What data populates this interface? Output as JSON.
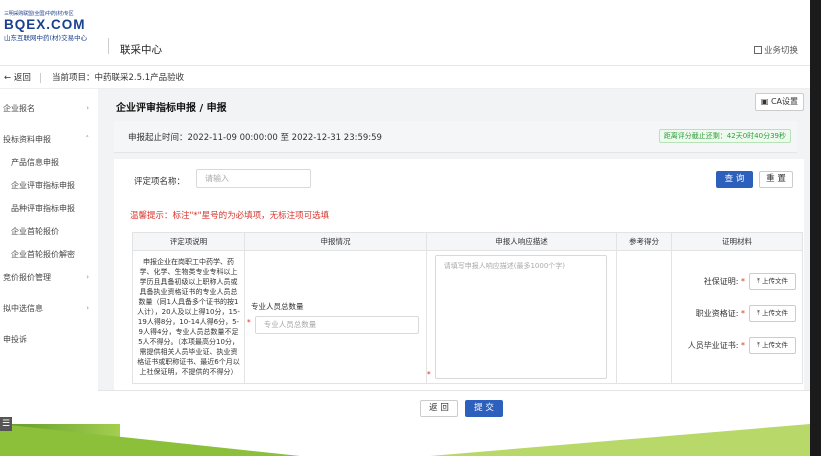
{
  "header": {
    "logo_top": "三明采购联盟(全国)中药(材)专区",
    "logo_brand": "BQEX.COM",
    "logo_sub": "山东互联网中药(材)交易中心",
    "system_title": "联采中心",
    "biz_switch": "业务切换"
  },
  "topbar": {
    "back": "返回",
    "project": "当前项目：中药联采2.5.1产品验收"
  },
  "sidebar": {
    "items": [
      {
        "label": "企业报名",
        "chevron": "›"
      },
      {
        "label": "投标资料申报",
        "chevron": "˄"
      },
      {
        "label": "产品信息申报"
      },
      {
        "label": "企业评审指标申报"
      },
      {
        "label": "品种评审指标申报"
      },
      {
        "label": "企业首轮报价"
      },
      {
        "label": "企业首轮报价解密"
      },
      {
        "label": "竞价报价管理",
        "chevron": "›"
      },
      {
        "label": "拟中选信息",
        "chevron": "›"
      },
      {
        "label": "申投诉"
      }
    ]
  },
  "main": {
    "breadcrumb": "企业评审指标申报 / 申报",
    "ca_button": "CA设置",
    "time_range": "申报起止时间：2022-11-09 00:00:00 至 2022-12-31 23:59:59",
    "deadline": "距离评分截止还剩：42天0时40分39秒",
    "search_label": "评定项名称：",
    "search_placeholder": "请输入",
    "query_button": "查 询",
    "reset_button": "重 置",
    "tip": "温馨提示：标注\"*\"星号的为必填项，无标注项可选填",
    "table": {
      "headers": [
        "评定项说明",
        "申报情况",
        "申报人响应描述",
        "参考得分",
        "证明材料"
      ],
      "row": {
        "description": "申报企业在岗职工中药学、药学、化学、生物类专业专科以上学历且具备初级以上职称人员或具备执业资格证书的专业人员总数量（同1人具备多个证书的按1人计），20人及以上得10分，15-19人得8分，10-14人得6分，5-9人得4分，专业人员总数量不足5人不得分。（本项最高分10分，需提供相关人员毕业证、执业资格证书或职称证书、最近6个月以上社保证明，不提供的不得分）",
        "field_label": "专业人员总数量",
        "field_placeholder": "专业人员总数量",
        "response_placeholder": "请填写申报人响应描述(最多1000个字)",
        "proofs": [
          {
            "label": "社保证明:",
            "button": "上传文件"
          },
          {
            "label": "职业资格证:",
            "button": "上传文件"
          },
          {
            "label": "人员毕业证书:",
            "button": "上传文件"
          }
        ]
      }
    }
  },
  "footer": {
    "back_button": "返 回",
    "submit_button": "提 交"
  }
}
